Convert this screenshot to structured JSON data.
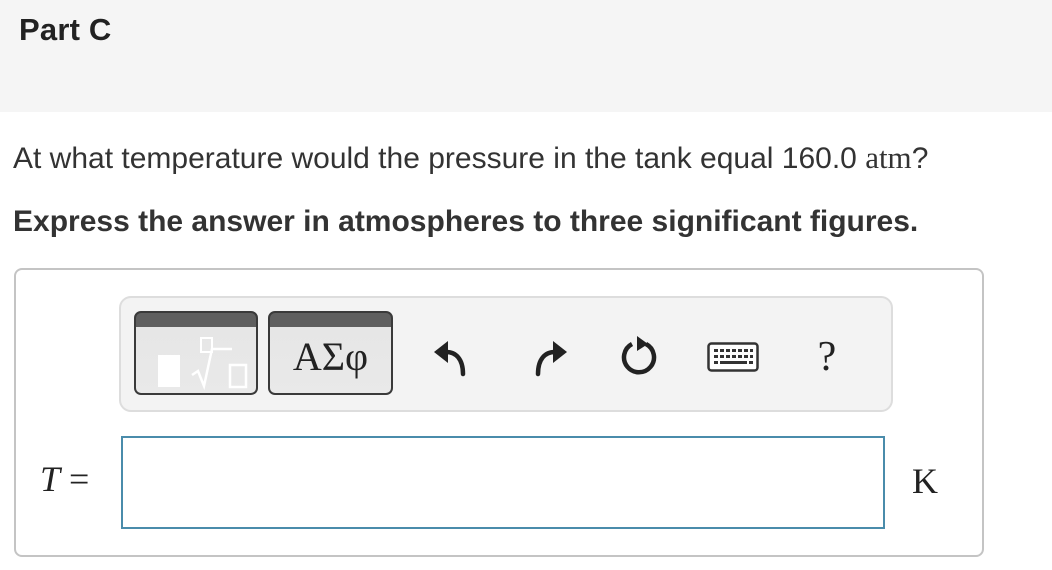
{
  "header": {
    "part_title": "Part C"
  },
  "question": {
    "text": "At what temperature would the pressure in the tank equal 160.0 ",
    "unit": "atm",
    "end": "?"
  },
  "instruction": "Express the answer in atmospheres to three significant figures.",
  "toolbar": {
    "templates_button": "templates-sqrt-icon",
    "symbols_label": "ΑΣφ",
    "undo_icon": "undo-arrow-icon",
    "redo_icon": "redo-arrow-icon",
    "reset_icon": "reset-circular-arrow-icon",
    "keyboard_icon": "keyboard-icon",
    "help_label": "?"
  },
  "answer": {
    "variable": "T",
    "equals": " =",
    "value": "",
    "unit": "K"
  }
}
